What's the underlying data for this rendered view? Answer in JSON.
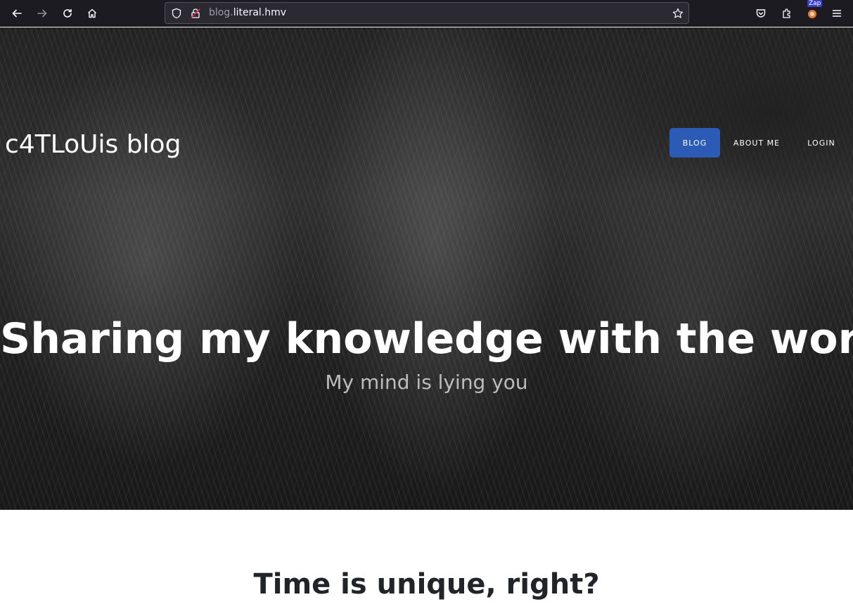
{
  "browser": {
    "url_subdomain": "blog.",
    "url_domain": "literal.hmv",
    "extension_badge": "Zap",
    "icons": [
      "back-icon",
      "forward-icon",
      "reload-icon",
      "home-icon",
      "shield-icon",
      "insecure-lock-icon",
      "bookmark-star-icon",
      "pocket-icon",
      "extensions-icon",
      "zap-icon",
      "menu-icon"
    ]
  },
  "site": {
    "brand": "c4TLoUis blog",
    "nav": [
      {
        "label": "BLOG",
        "active": true
      },
      {
        "label": "ABOUT ME",
        "active": false
      },
      {
        "label": "LOGIN",
        "active": false
      }
    ],
    "hero_title": "Sharing my knowledge with the world",
    "hero_subtitle": "My mind is lying you"
  },
  "content": {
    "post_title": "Time is unique, right?"
  },
  "colors": {
    "toolbar_bg": "#1c1b22",
    "urlbar_bg": "#2b2a33",
    "nav_active_bg": "#2b5bb5",
    "post_title": "#212529"
  }
}
